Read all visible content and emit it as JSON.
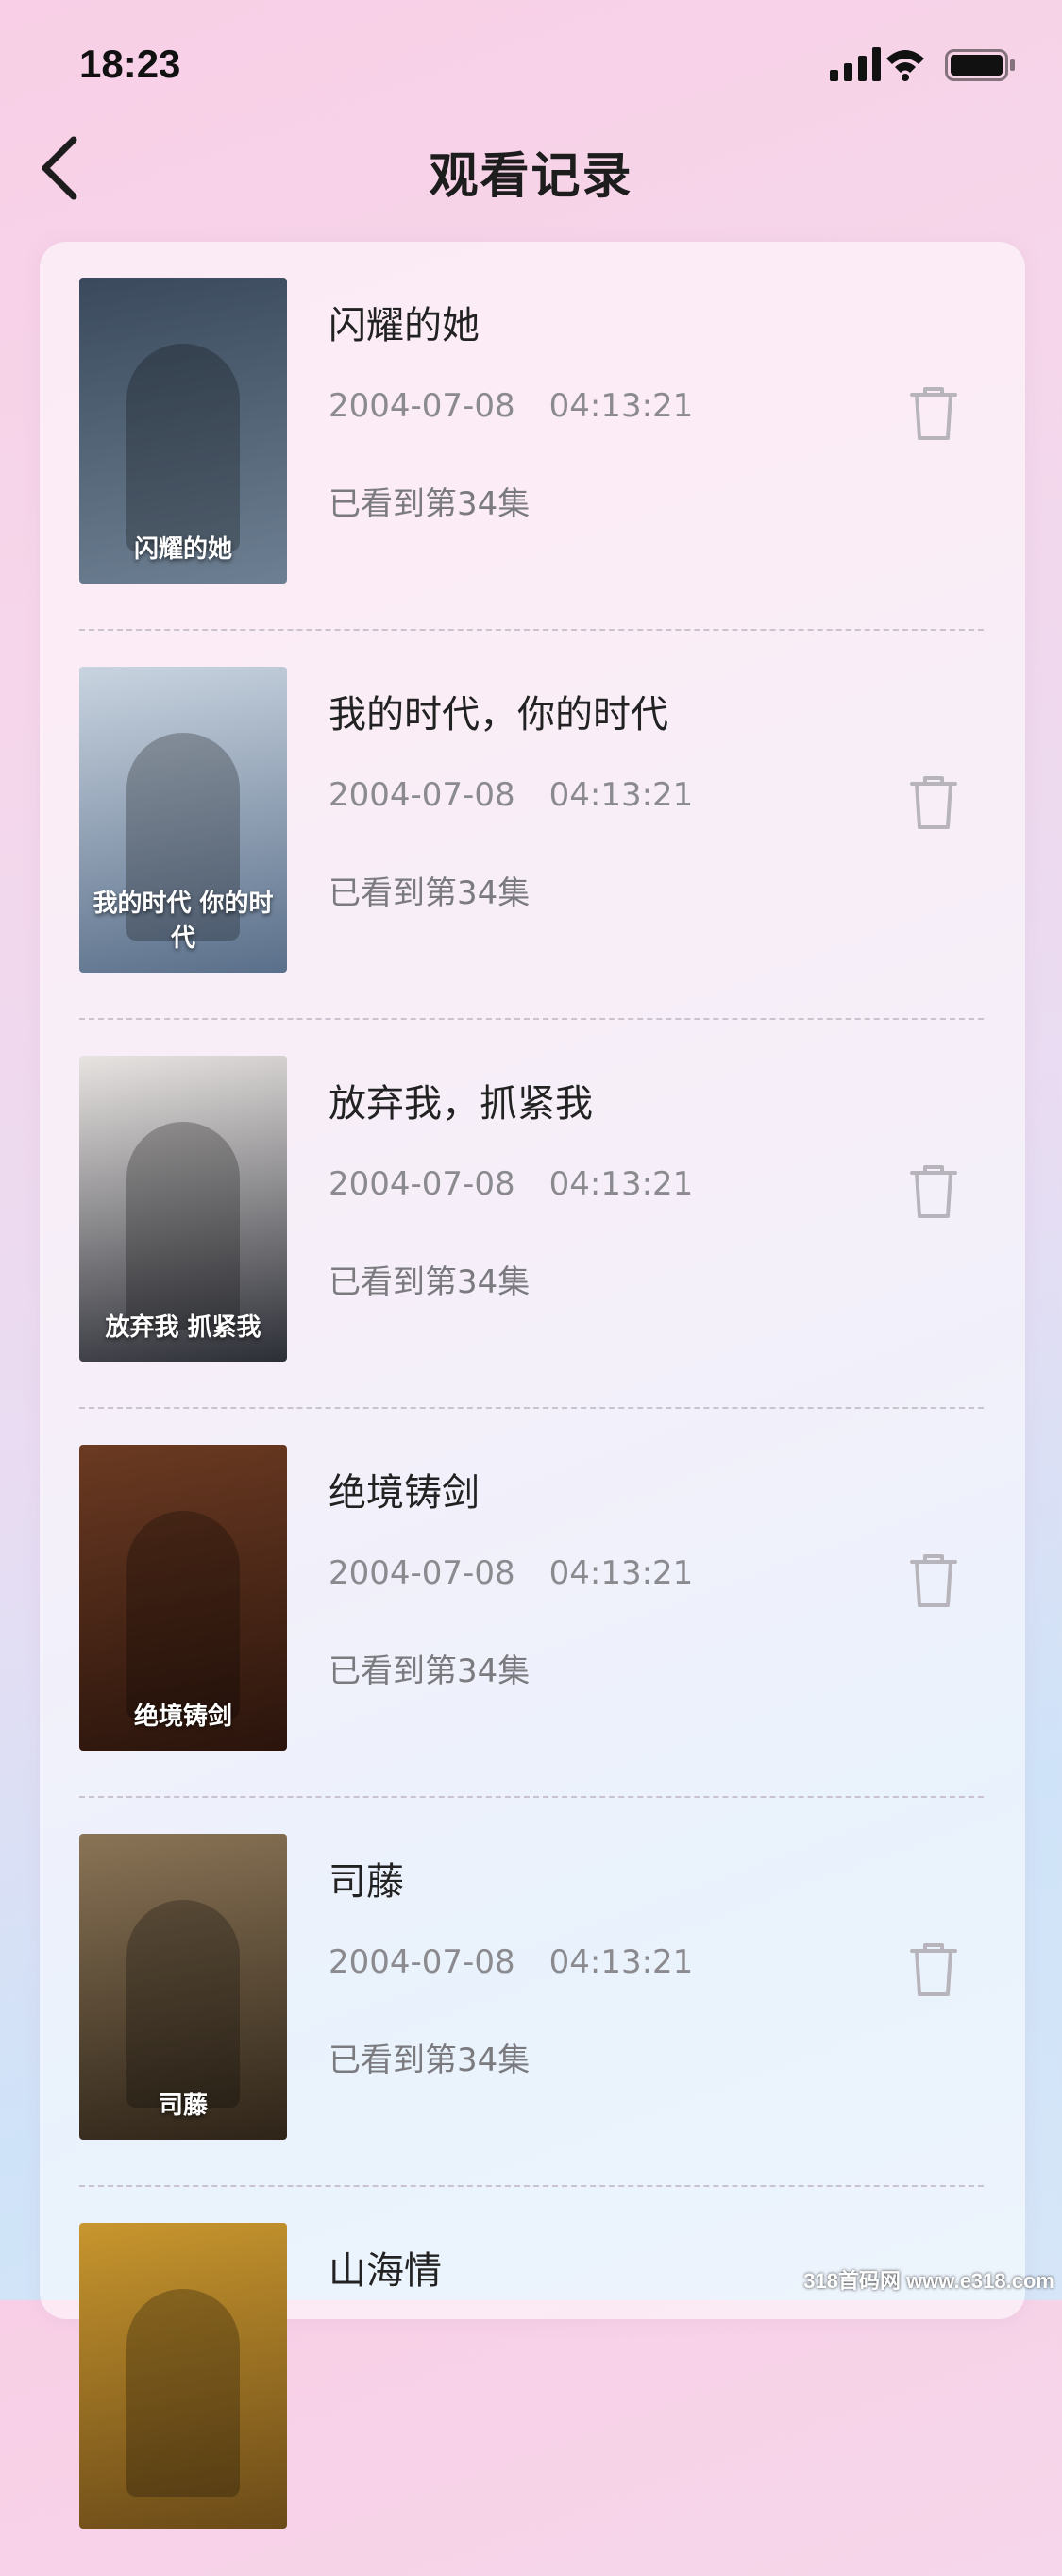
{
  "status_bar": {
    "time": "18:23"
  },
  "nav": {
    "title": "观看记录"
  },
  "history": [
    {
      "title": "闪耀的她",
      "date": "2004-07-08",
      "time": "04:13:21",
      "progress": "已看到第34集",
      "poster_text": "闪耀的她",
      "poster_colors": [
        "#3a4a5c",
        "#6d7f92"
      ]
    },
    {
      "title": "我的时代，你的时代",
      "date": "2004-07-08",
      "time": "04:13:21",
      "progress": "已看到第34集",
      "poster_text": "我的时代 你的时代",
      "poster_colors": [
        "#c9d4e0",
        "#5a6f8a"
      ]
    },
    {
      "title": "放弃我，抓紧我",
      "date": "2004-07-08",
      "time": "04:13:21",
      "progress": "已看到第34集",
      "poster_text": "放弃我 抓紧我",
      "poster_colors": [
        "#e8e4e2",
        "#2c2e36"
      ]
    },
    {
      "title": "绝境铸剑",
      "date": "2004-07-08",
      "time": "04:13:21",
      "progress": "已看到第34集",
      "poster_text": "绝境铸剑",
      "poster_colors": [
        "#6b3a22",
        "#2a140c"
      ]
    },
    {
      "title": "司藤",
      "date": "2004-07-08",
      "time": "04:13:21",
      "progress": "已看到第34集",
      "poster_text": "司藤",
      "poster_colors": [
        "#8a7456",
        "#2e2418"
      ]
    },
    {
      "title": "山海情",
      "date": "",
      "time": "",
      "progress": "",
      "poster_text": "",
      "poster_colors": [
        "#c8962e",
        "#6a4a18"
      ]
    }
  ],
  "watermark": "318首码网 www.e318.com"
}
